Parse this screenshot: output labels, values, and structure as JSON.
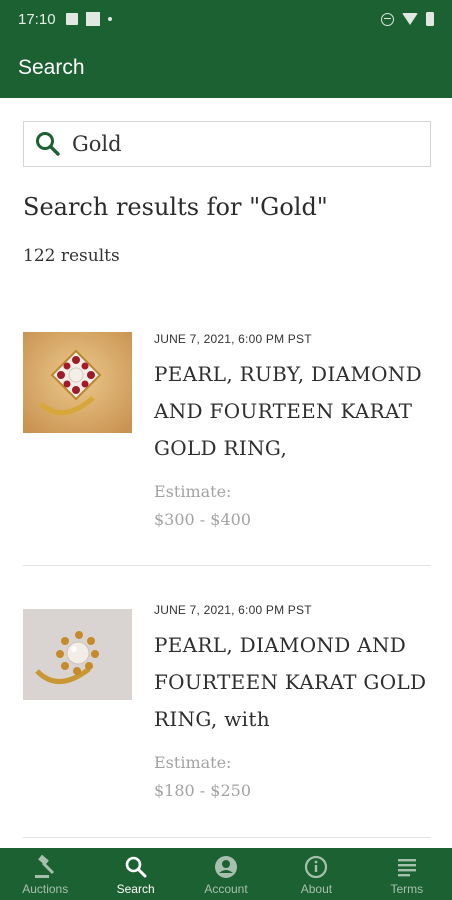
{
  "status_bar": {
    "time": "17:10"
  },
  "app_bar": {
    "title": "Search"
  },
  "search": {
    "value": "Gold",
    "placeholder": "Search"
  },
  "results_header": {
    "title": "Search results for \"Gold\"",
    "count": "122 results"
  },
  "results": [
    {
      "date": "JUNE 7, 2021, 6:00 PM PST",
      "title": "PEARL, RUBY, DIAMOND AND FOURTEEN KARAT GOLD RING,",
      "estimate_label": "Estimate:",
      "estimate_value": "$300 - $400"
    },
    {
      "date": "JUNE 7, 2021, 6:00 PM PST",
      "title": "PEARL, DIAMOND AND FOURTEEN KARAT GOLD RING, with",
      "estimate_label": "Estimate:",
      "estimate_value": "$180 - $250"
    }
  ],
  "bottom_nav": {
    "items": [
      {
        "label": "Auctions",
        "icon": "gavel-icon"
      },
      {
        "label": "Search",
        "icon": "search-icon",
        "active": true
      },
      {
        "label": "Account",
        "icon": "account-icon"
      },
      {
        "label": "About",
        "icon": "info-icon"
      },
      {
        "label": "Terms",
        "icon": "document-lines-icon"
      }
    ]
  },
  "colors": {
    "primary": "#1c6132",
    "estimate_text": "#a3a3a3",
    "nav_inactive": "#a7c0ae"
  }
}
